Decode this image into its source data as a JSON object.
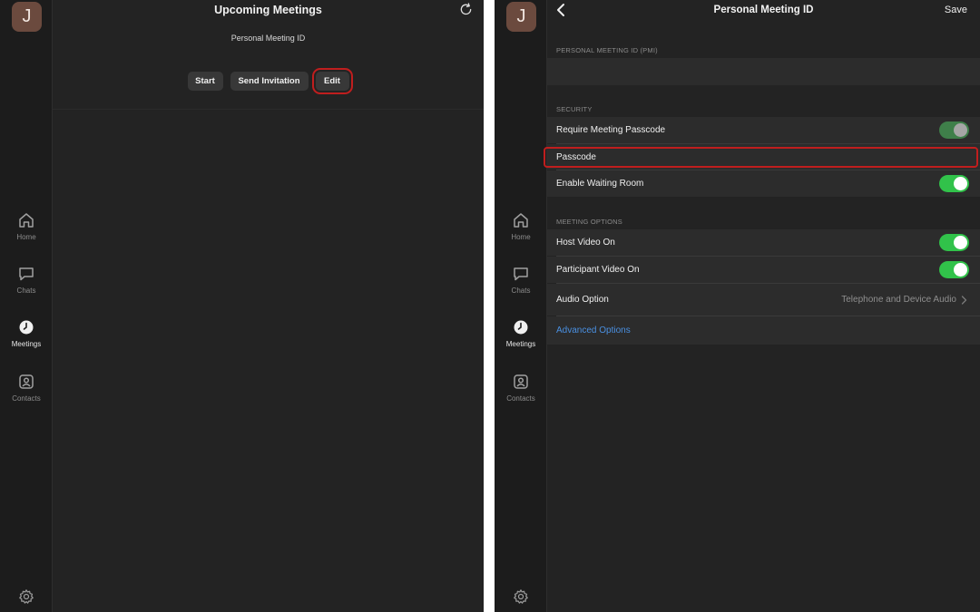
{
  "sidebar": {
    "avatar_initial": "J",
    "items": [
      {
        "label": "Home",
        "icon": "home-icon"
      },
      {
        "label": "Chats",
        "icon": "chat-icon"
      },
      {
        "label": "Meetings",
        "icon": "clock-icon",
        "active": true
      },
      {
        "label": "Contacts",
        "icon": "contacts-icon"
      }
    ],
    "settings_icon": "gear-icon"
  },
  "left_screen": {
    "title": "Upcoming Meetings",
    "subtitle": "Personal Meeting ID",
    "buttons": {
      "start": "Start",
      "send_invitation": "Send Invitation",
      "edit": "Edit"
    },
    "refresh_icon": "refresh-icon"
  },
  "right_screen": {
    "title": "Personal Meeting ID",
    "save_label": "Save",
    "pmi_header": "PERSONAL MEETING ID (PMI)",
    "pmi_value": "",
    "security_header": "SECURITY",
    "security_rows": [
      {
        "label": "Require Meeting Passcode",
        "toggle": "on-disabled"
      },
      {
        "label": "Passcode"
      },
      {
        "label": "Enable Waiting Room",
        "toggle": "on"
      }
    ],
    "options_header": "MEETING OPTIONS",
    "option_rows": [
      {
        "label": "Host Video On",
        "toggle": "on"
      },
      {
        "label": "Participant Video On",
        "toggle": "on"
      },
      {
        "label": "Audio Option",
        "value": "Telephone and Device Audio"
      },
      {
        "label": "Advanced Options"
      }
    ]
  },
  "colors": {
    "background": "#232323",
    "sidebar": "#1c1c1c",
    "row": "#2c2c2c",
    "toggle_on": "#31c24a",
    "link": "#4a90e2",
    "highlight": "#c01e1e",
    "avatar": "#6b4a3e"
  }
}
